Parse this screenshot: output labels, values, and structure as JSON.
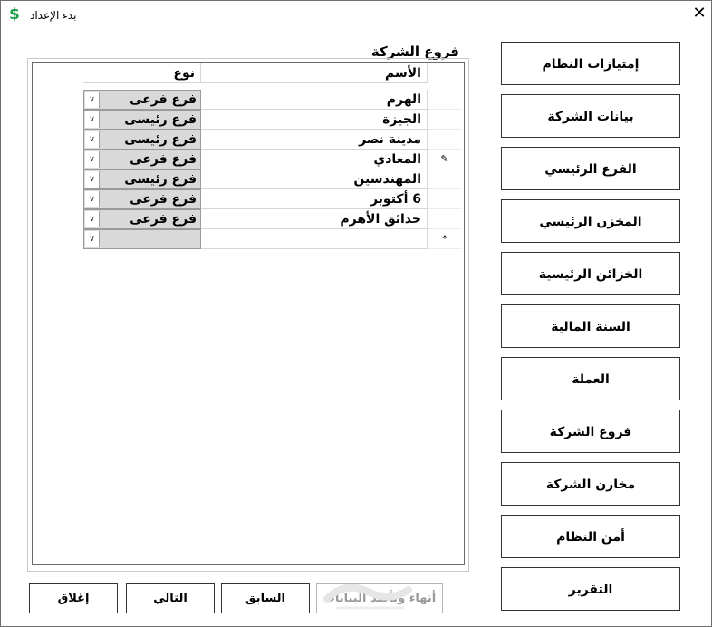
{
  "window": {
    "title": "بدء الإعداد",
    "app_icon": "$",
    "close_icon": "✕"
  },
  "grid": {
    "group_title": "فروع الشركة",
    "columns": {
      "name": "الأسم",
      "type": "نوع"
    },
    "current_row_marker": "✎",
    "new_row_marker": "*",
    "rows": [
      {
        "name": "الهرم",
        "type": "فرع فرعى"
      },
      {
        "name": "الجيزة",
        "type": "فرع رئيسى"
      },
      {
        "name": "مدينة نصر",
        "type": "فرع رئيسى"
      },
      {
        "name": "المعادي",
        "type": "فرع فرعى"
      },
      {
        "name": "المهندسين",
        "type": "فرع رئيسى"
      },
      {
        "name": "6 أكتوبر",
        "type": "فرع فرعى"
      },
      {
        "name": "حدائق الأهرم",
        "type": "فرع فرعى"
      }
    ]
  },
  "sidebar": [
    "إمتيازات النظام",
    "بيانات الشركة",
    "الفرع الرئيسي",
    "المخزن الرئيسي",
    "الخزائن الرئيسية",
    "السنة المالية",
    "العملة",
    "فروع الشركة",
    "مخازن الشركة",
    "أمن النظام",
    "التقرير"
  ],
  "buttons": {
    "close": "إغلاق",
    "next": "التالي",
    "previous": "السابق",
    "finish": "أنهاء وتأكيد البيانات"
  },
  "colors": {
    "accent": "#1a9e4a",
    "combo_bg": "#d9d9d9"
  }
}
